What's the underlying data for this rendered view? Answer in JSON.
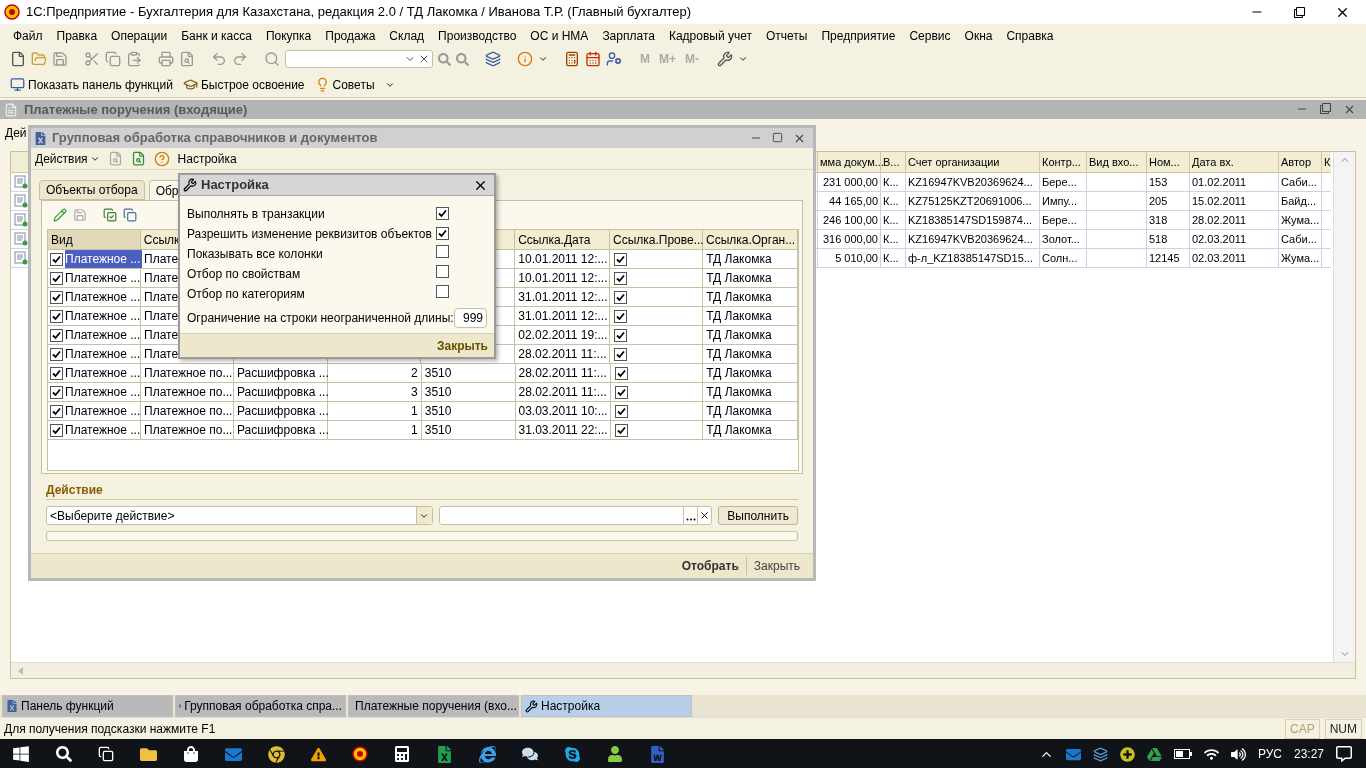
{
  "window": {
    "title": "1С:Предприятие - Бухгалтерия для Казахстана, редакция 2.0 / ТД Лакомка / Иванова Т.Р. (Главный бухгалтер)"
  },
  "menu": [
    "Файл",
    "Правка",
    "Операции",
    "Банк и касса",
    "Покупка",
    "Продажа",
    "Склад",
    "Производство",
    "ОС и НМА",
    "Зарплата",
    "Кадровый учет",
    "Отчеты",
    "Предприятие",
    "Сервис",
    "Окна",
    "Справка"
  ],
  "memory_buttons": [
    "M",
    "M+",
    "M-"
  ],
  "toolbar2": [
    {
      "label": "Показать панель функций"
    },
    {
      "label": "Быстрое освоение"
    },
    {
      "label": "Советы"
    }
  ],
  "doc_window": {
    "title": "Платежные поручения (входящие)",
    "toolbar_text": "Дей",
    "columns": [
      "мма докум...",
      "В...",
      "Счет организации",
      "Контр...",
      "Вид вхо...",
      "Ном...",
      "Дата вх.",
      "Автор",
      "К"
    ],
    "rows": [
      {
        "amount": "231 000,00",
        "column_2": "К...",
        "account": "KZ16947KVB20369624...",
        "counterparty": "Бере...",
        "number": "153",
        "incoming_date": "01.02.2011",
        "author": "Саби..."
      },
      {
        "amount": "44 165,00",
        "column_2": "К...",
        "account": "KZ75125KZT20691006...",
        "counterparty": "Импу...",
        "number": "205",
        "incoming_date": "15.02.2011",
        "author": "Байд..."
      },
      {
        "amount": "246 100,00",
        "column_2": "К...",
        "account": "KZ18385147SD159874...",
        "counterparty": "Бере...",
        "number": "318",
        "incoming_date": "28.02.2011",
        "author": "Жума..."
      },
      {
        "amount": "316 000,00",
        "column_2": "К...",
        "account": "KZ16947KVB20369624...",
        "counterparty": "Золот...",
        "number": "518",
        "incoming_date": "02.03.2011",
        "author": "Саби..."
      },
      {
        "amount": "5 010,00",
        "column_2": "К...",
        "account": "ф-л_KZ18385147SD15...",
        "counterparty": "Солн...",
        "number": "12145",
        "incoming_date": "02.03.2011",
        "author": "Жума..."
      }
    ]
  },
  "group_dialog": {
    "title": "Групповая обработка справочников и документов",
    "actions_menu": "Действия",
    "settings_button": "Настройка",
    "tabs": [
      {
        "label": "Объекты отбора",
        "selected": false
      },
      {
        "label": "Обр",
        "selected": true
      }
    ],
    "headers": {
      "kind": "Вид",
      "ref": "Ссылк",
      "date": "Ссылка.Дата",
      "posted": "Ссылка.Прове...",
      "org": "Ссылка.Орган..."
    },
    "rows": [
      {
        "selected": true,
        "checked": true,
        "kind": "Платежное ...",
        "ref": "Плате",
        "date": "10.01.2011 12:...",
        "posted": true,
        "org": "ТД Лакомка"
      },
      {
        "selected": false,
        "checked": true,
        "kind": "Платежное ...",
        "ref": "Плате",
        "date": "10.01.2011 12:...",
        "posted": true,
        "org": "ТД Лакомка"
      },
      {
        "selected": false,
        "checked": true,
        "kind": "Платежное ...",
        "ref": "Плате",
        "date": "31.01.2011 12:...",
        "posted": true,
        "org": "ТД Лакомка"
      },
      {
        "selected": false,
        "checked": true,
        "kind": "Платежное ...",
        "ref": "Плате",
        "date": "31.01.2011 12:...",
        "posted": true,
        "org": "ТД Лакомка"
      },
      {
        "selected": false,
        "checked": true,
        "kind": "Платежное ...",
        "ref": "Плате",
        "date": "02.02.2011 19:...",
        "posted": true,
        "org": "ТД Лакомка"
      },
      {
        "selected": false,
        "checked": true,
        "kind": "Платежное ...",
        "ref": "Плате",
        "date": "28.02.2011 11:...",
        "posted": true,
        "org": "ТД Лакомка"
      },
      {
        "selected": false,
        "checked": true,
        "kind": "Платежное ...",
        "ref": "Платежное по...",
        "column_3": "Расшифровка ...",
        "column_4": "2",
        "column_5": "3510",
        "date": "28.02.2011 11:...",
        "posted": true,
        "org": "ТД Лакомка"
      },
      {
        "selected": false,
        "checked": true,
        "kind": "Платежное ...",
        "ref": "Платежное по...",
        "column_3": "Расшифровка ...",
        "column_4": "3",
        "column_5": "3510",
        "date": "28.02.2011 11:...",
        "posted": true,
        "org": "ТД Лакомка"
      },
      {
        "selected": false,
        "checked": true,
        "kind": "Платежное ...",
        "ref": "Платежное по...",
        "column_3": "Расшифровка ...",
        "column_4": "1",
        "column_5": "3510",
        "date": "03.03.2011 10:...",
        "posted": true,
        "org": "ТД Лакомка"
      },
      {
        "selected": false,
        "checked": true,
        "kind": "Платежное ...",
        "ref": "Платежное по...",
        "column_3": "Расшифровка ...",
        "column_4": "1",
        "column_5": "3510",
        "date": "31.03.2011 22:...",
        "posted": true,
        "org": "ТД Лакомка"
      }
    ],
    "action": {
      "label": "Действие",
      "select": "<Выберите действие>",
      "run_button": "Выполнить"
    },
    "progress": {
      "level": 0
    },
    "footer": [
      {
        "label": "Отобрать",
        "default": true
      },
      {
        "label": "Закрыть",
        "default": false
      }
    ]
  },
  "settings_dialog": {
    "title": "Настройка",
    "options": [
      {
        "label": "Выполнять в транзакции",
        "checked": true
      },
      {
        "label": "Разрешить изменение реквизитов объектов",
        "checked": true
      },
      {
        "label": "Показывать все колонки",
        "checked": false
      },
      {
        "label": "Отбор по свойствам",
        "checked": false
      },
      {
        "label": "Отбор по категориям",
        "checked": false
      }
    ],
    "limit": {
      "label": "Ограничение на строки неограниченной длины:",
      "value": "999"
    },
    "close_button": "Закрыть"
  },
  "window_tabs": [
    {
      "label": "Панель функций",
      "selected": false
    },
    {
      "label": "Групповая обработка спра...",
      "selected": false
    },
    {
      "label": "Платежные поручения (вхо...",
      "selected": false
    },
    {
      "label": "Настройка",
      "selected": true
    }
  ],
  "status_bar": {
    "hint": "Для получения подсказки нажмите F1",
    "indicators": [
      {
        "label": "CAP",
        "on": false
      },
      {
        "label": "NUM",
        "on": true
      }
    ]
  },
  "taskbar": {
    "language": "РУС",
    "time": "23:27"
  }
}
